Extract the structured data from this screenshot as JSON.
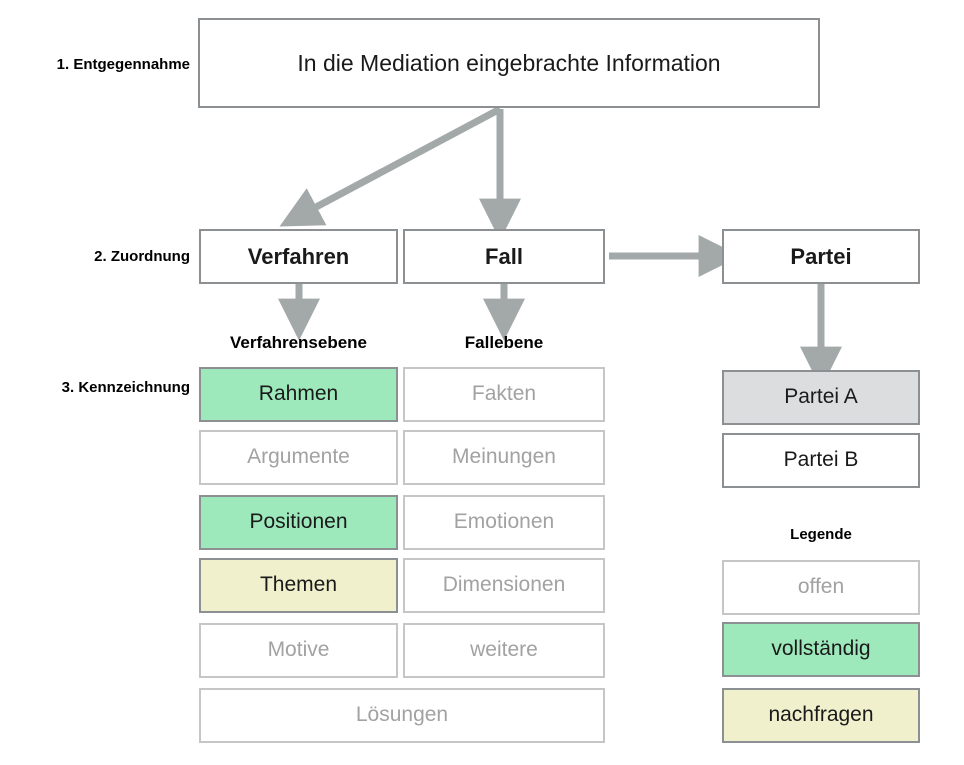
{
  "stages": [
    {
      "id": "entgegennahme",
      "label": "1. Entgegennahme"
    },
    {
      "id": "zuordnung",
      "label": "2. Zuordnung"
    },
    {
      "id": "kennzeichnung",
      "label": "3. Kennzeichnung"
    }
  ],
  "top_box": {
    "label": "In die Mediation eingebrachte Information"
  },
  "entities": [
    {
      "id": "verfahren",
      "label": "Verfahren"
    },
    {
      "id": "fall",
      "label": "Fall"
    },
    {
      "id": "partei",
      "label": "Partei"
    }
  ],
  "column_labels": [
    {
      "id": "verfahrensebene",
      "label": "Verfahrensebene"
    },
    {
      "id": "fallebene",
      "label": "Fallebene"
    }
  ],
  "verfahrensebene_items": [
    {
      "label": "Rahmen",
      "state": "vollstaendig"
    },
    {
      "label": "Argumente",
      "state": "offen"
    },
    {
      "label": "Positionen",
      "state": "vollstaendig"
    },
    {
      "label": "Themen",
      "state": "nachfragen"
    },
    {
      "label": "Motive",
      "state": "offen"
    }
  ],
  "fallebene_items": [
    {
      "label": "Fakten",
      "state": "offen"
    },
    {
      "label": "Meinungen",
      "state": "offen"
    },
    {
      "label": "Emotionen",
      "state": "offen"
    },
    {
      "label": "Dimensionen",
      "state": "offen"
    },
    {
      "label": "weitere",
      "state": "offen"
    }
  ],
  "spanning_item": {
    "label": "Lösungen",
    "state": "offen"
  },
  "parteien": [
    {
      "label": "Partei A",
      "state": "selected"
    },
    {
      "label": "Partei B",
      "state": "neutral"
    }
  ],
  "legend": {
    "title": "Legende",
    "items": [
      {
        "label": "offen",
        "state": "offen"
      },
      {
        "label": "vollständig",
        "state": "vollstaendig"
      },
      {
        "label": "nachfragen",
        "state": "nachfragen"
      }
    ]
  },
  "colors": {
    "vollstaendig": "#9de9bb",
    "nachfragen": "#f0f0cd",
    "selected_grey": "#dcdddf",
    "border_strong": "#8c9093",
    "border_light": "#c6c6c6",
    "text_muted": "#a2a2a2",
    "arrow": "#a3a8a9"
  }
}
